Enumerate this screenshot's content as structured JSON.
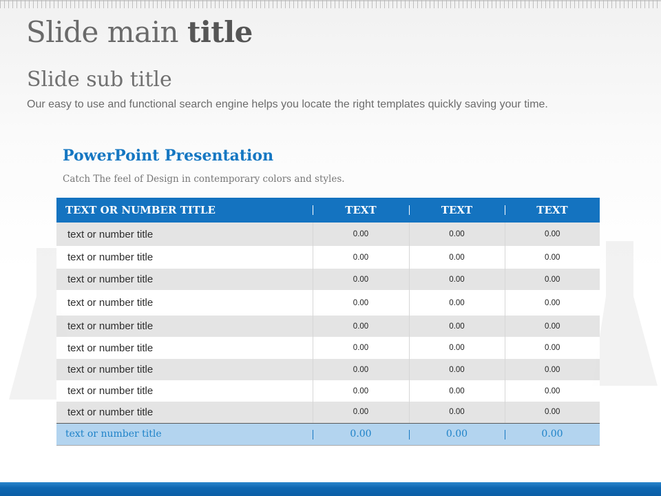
{
  "slide": {
    "title_regular": "Slide main ",
    "title_bold": "title",
    "subtitle": "Slide sub title",
    "description": "Our easy to use and functional search engine helps you locate the right templates quickly  saving your time."
  },
  "content": {
    "heading": "PowerPoint Presentation",
    "tagline": "Catch The feel of Design in contemporary colors and styles."
  },
  "table": {
    "headers": [
      "TEXT OR NUMBER TITLE",
      "TEXT",
      "TEXT",
      "TEXT"
    ],
    "rows": [
      [
        "text or number title",
        "0.00",
        "0.00",
        "0.00"
      ],
      [
        "text or number title",
        "0.00",
        "0.00",
        "0.00"
      ],
      [
        "text or number title",
        "0.00",
        "0.00",
        "0.00"
      ],
      [
        "text or number title",
        "0.00",
        "0.00",
        "0.00"
      ],
      [
        "text or number title",
        "0.00",
        "0.00",
        "0.00"
      ],
      [
        "text or number title",
        "0.00",
        "0.00",
        "0.00"
      ],
      [
        "text or number title",
        "0.00",
        "0.00",
        "0.00"
      ],
      [
        "text or number title",
        "0.00",
        "0.00",
        "0.00"
      ],
      [
        "text or number title",
        "0.00",
        "0.00",
        "0.00"
      ]
    ],
    "footer": [
      "text or number title",
      "0.00",
      "0.00",
      "0.00"
    ]
  },
  "colors": {
    "accent": "#1473c0",
    "footer_row": "#b3d4ef",
    "shaded_row": "#e2e2e2"
  }
}
